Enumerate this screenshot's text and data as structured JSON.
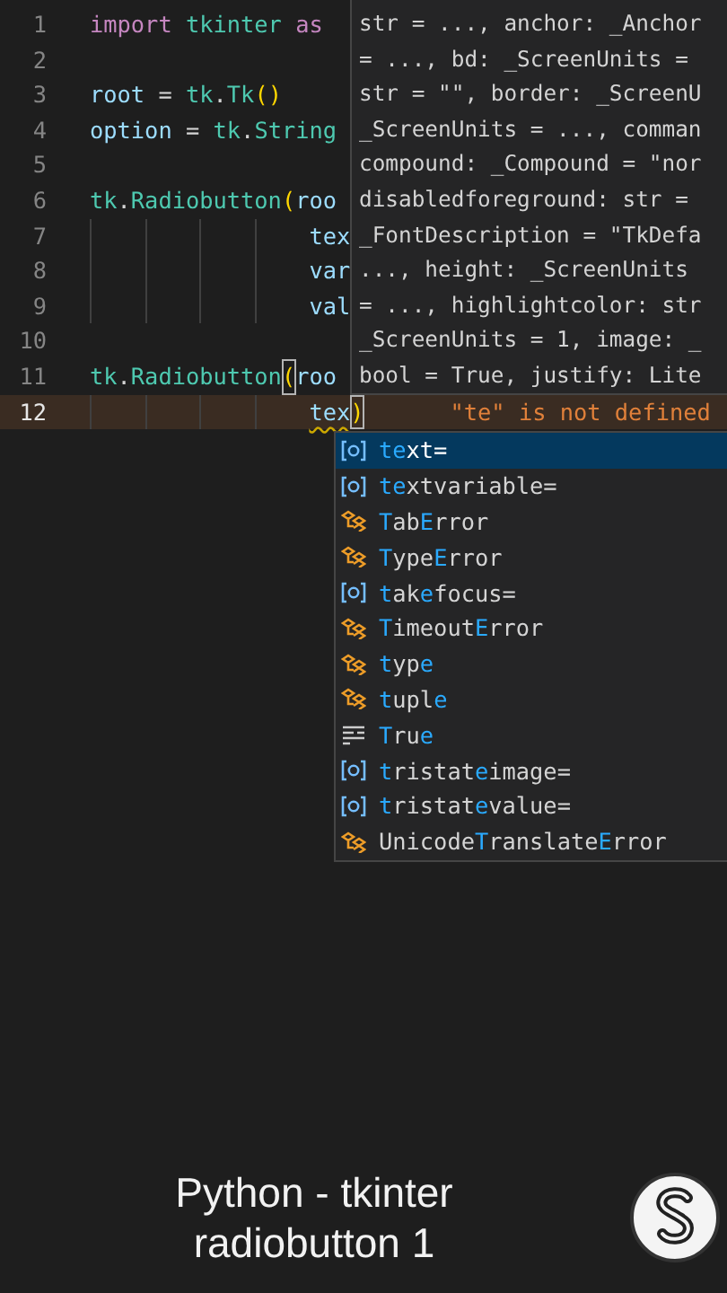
{
  "editor": {
    "lines": [
      {
        "number": "1",
        "continuation": false,
        "current": false,
        "tokens": [
          {
            "kind": "keyword",
            "text": "import"
          },
          {
            "kind": "class",
            "text": "tkinter",
            "space_before": true
          },
          {
            "kind": "keyword",
            "text": "as",
            "space_before": true
          }
        ]
      },
      {
        "number": "2",
        "continuation": false,
        "current": false
      },
      {
        "number": "3",
        "continuation": false,
        "current": false,
        "tokens": [
          {
            "kind": "variable",
            "text": "root"
          },
          {
            "kind": "plain",
            "text": " = "
          },
          {
            "kind": "class",
            "text": "tk"
          },
          {
            "kind": "plain",
            "text": "."
          },
          {
            "kind": "class",
            "text": "Tk"
          },
          {
            "kind": "bracket",
            "text": "()"
          }
        ]
      },
      {
        "number": "4",
        "continuation": false,
        "current": false,
        "tokens": [
          {
            "kind": "variable",
            "text": "option"
          },
          {
            "kind": "plain",
            "text": " = "
          },
          {
            "kind": "class",
            "text": "tk"
          },
          {
            "kind": "plain",
            "text": "."
          },
          {
            "kind": "class",
            "text": "String"
          }
        ]
      },
      {
        "number": "5",
        "continuation": false,
        "current": false
      },
      {
        "number": "6",
        "continuation": false,
        "current": false,
        "tokens": [
          {
            "kind": "class",
            "text": "tk"
          },
          {
            "kind": "plain",
            "text": "."
          },
          {
            "kind": "class",
            "text": "Radiobutton"
          },
          {
            "kind": "bracket",
            "text": "("
          },
          {
            "kind": "variable",
            "text": "roo"
          }
        ]
      },
      {
        "number": "7",
        "continuation": true,
        "current": false,
        "tokens": [
          {
            "kind": "variable",
            "text": "tex"
          }
        ]
      },
      {
        "number": "8",
        "continuation": true,
        "current": false,
        "tokens": [
          {
            "kind": "variable",
            "text": "var"
          }
        ]
      },
      {
        "number": "9",
        "continuation": true,
        "current": false,
        "tokens": [
          {
            "kind": "variable",
            "text": "val"
          }
        ]
      },
      {
        "number": "10",
        "continuation": false,
        "current": false
      },
      {
        "number": "11",
        "continuation": false,
        "current": false,
        "tokens": [
          {
            "kind": "class",
            "text": "tk"
          },
          {
            "kind": "plain",
            "text": "."
          },
          {
            "kind": "class",
            "text": "Radiobutton"
          },
          {
            "kind": "bracket",
            "text": "(",
            "matched": true
          },
          {
            "kind": "variable",
            "text": "roo"
          }
        ]
      },
      {
        "number": "12",
        "continuation": true,
        "current": true,
        "tokens": [
          {
            "kind": "variable",
            "text": "tex",
            "error": true
          },
          {
            "kind": "bracket",
            "text": ")",
            "matched": true
          }
        ],
        "diagnostic": "\"te\" is not defined"
      }
    ]
  },
  "hover": {
    "lines": [
      "str = ..., anchor: _Anchor",
      "= ..., bd: _ScreenUnits =",
      "str = \"\", border: _ScreenU",
      "_ScreenUnits = ..., comman",
      "compound: _Compound = \"nor",
      "disabledforeground: str =",
      "_FontDescription = \"TkDefa",
      "..., height: _ScreenUnits",
      "= ..., highlightcolor: str",
      "_ScreenUnits = 1, image: _",
      "bool = True, justify: Lite"
    ]
  },
  "completion": {
    "items": [
      {
        "kind": "field",
        "label": "**te**xt=",
        "selected": true
      },
      {
        "kind": "field",
        "label": "**te**xtvariable=",
        "selected": false
      },
      {
        "kind": "class",
        "label": "**T**ab**E**rror",
        "selected": false
      },
      {
        "kind": "class",
        "label": "**T**ype**E**rror",
        "selected": false
      },
      {
        "kind": "field",
        "label": "**t**ak**e**focus=",
        "selected": false
      },
      {
        "kind": "class",
        "label": "**T**imeout**E**rror",
        "selected": false
      },
      {
        "kind": "class",
        "label": "**t**yp**e**",
        "selected": false
      },
      {
        "kind": "class",
        "label": "**t**upl**e**",
        "selected": false
      },
      {
        "kind": "keyword",
        "label": "**T**ru**e**",
        "selected": false
      },
      {
        "kind": "field",
        "label": "**t**ristat**e**image=",
        "selected": false
      },
      {
        "kind": "field",
        "label": "**t**ristat**e**value=",
        "selected": false
      },
      {
        "kind": "class",
        "label": "Unicode**T**ranslate**E**rror",
        "selected": false
      }
    ]
  },
  "caption": {
    "title": "Python - tkinter",
    "subtitle": "radiobutton 1"
  }
}
